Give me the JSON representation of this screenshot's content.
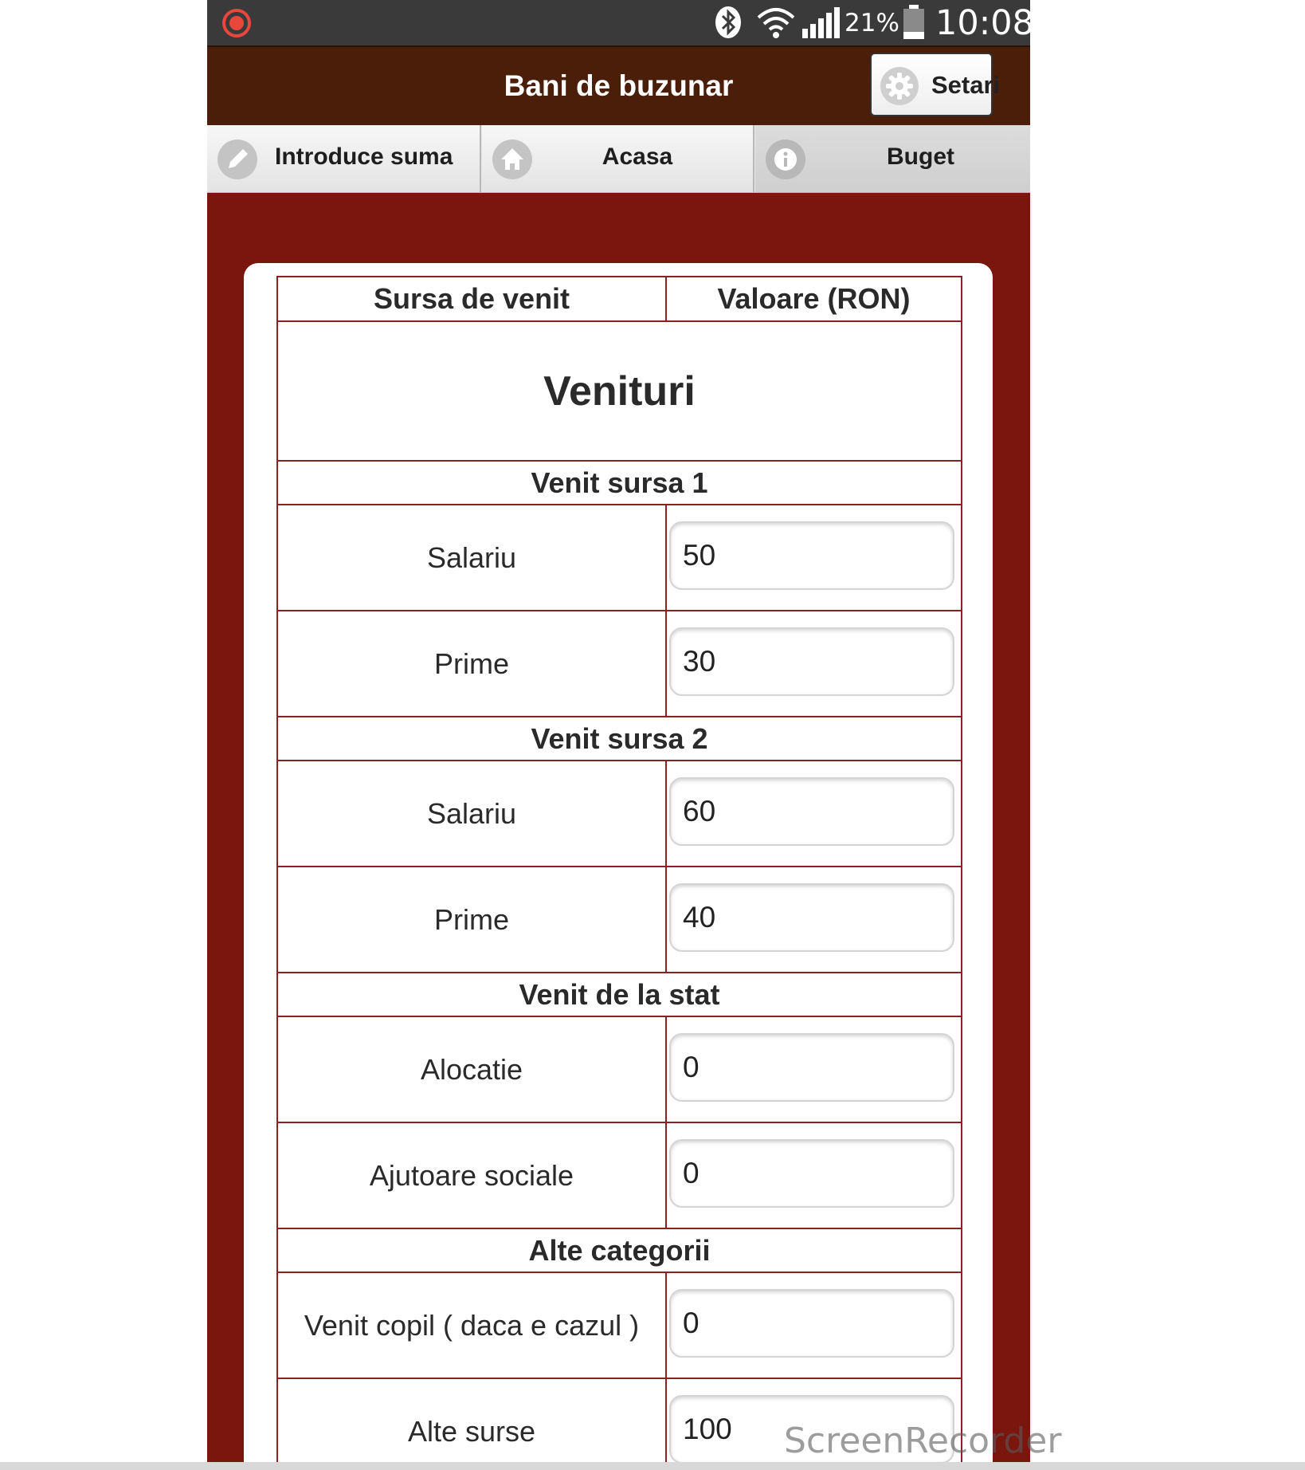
{
  "status_bar": {
    "battery_percent": "21%",
    "time": "10:08"
  },
  "header": {
    "title": "Bani de buzunar",
    "settings_label": "Setari"
  },
  "tabs": [
    {
      "label": "Introduce suma",
      "icon": "pencil-icon"
    },
    {
      "label": "Acasa",
      "icon": "home-icon"
    },
    {
      "label": "Buget",
      "icon": "info-icon",
      "active": true
    }
  ],
  "table": {
    "col_source": "Sursa de venit",
    "col_value": "Valoare (RON)",
    "section_title": "Venituri",
    "groups": [
      {
        "title": "Venit sursa 1",
        "items": [
          {
            "label": "Salariu",
            "value": "50"
          },
          {
            "label": "Prime",
            "value": "30"
          }
        ]
      },
      {
        "title": "Venit sursa 2",
        "items": [
          {
            "label": "Salariu",
            "value": "60"
          },
          {
            "label": "Prime",
            "value": "40"
          }
        ]
      },
      {
        "title": "Venit de la stat",
        "items": [
          {
            "label": "Alocatie",
            "value": "0"
          },
          {
            "label": "Ajutoare sociale",
            "value": "0"
          }
        ]
      },
      {
        "title": "Alte categorii",
        "items": [
          {
            "label": "Venit copil ( daca e cazul )",
            "value": "0"
          },
          {
            "label": "Alte surse",
            "value": "100"
          }
        ]
      }
    ]
  },
  "watermark": "ScreenRecorder",
  "colors": {
    "status_bar": "#3a3a3a",
    "header_bg": "#4a1e08",
    "page_bg": "#7a160d",
    "table_border": "#8a2222",
    "record_dot": "#e8473b"
  }
}
